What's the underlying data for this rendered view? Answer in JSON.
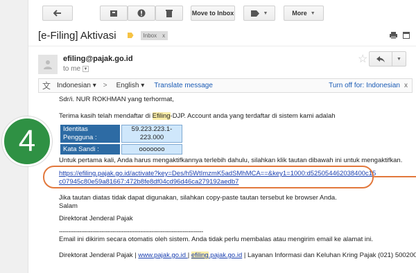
{
  "toolbar": {
    "move_to_inbox": "Move to Inbox",
    "more": "More"
  },
  "email": {
    "subject": "[e-Filing] Aktivasi",
    "label": "Inbox",
    "label_close": "x",
    "sender": "efiling@pajak.go.id",
    "to": "to me"
  },
  "translate": {
    "from": "Indonesian",
    "arrow": ">",
    "to": "English",
    "action": "Translate message",
    "turn_off": "Turn off for: Indonesian",
    "close": "x"
  },
  "message": {
    "greeting": "Sdr/i.  NUR ROKHMAN yang terhormat,",
    "intro_1": "Terima kasih telah mendaftar di ",
    "intro_hl": "Efiling",
    "intro_2": "-DJP.  Account anda yang terdaftar di sistem kami adalah",
    "id_label": "Identitas Pengguna :",
    "id_value": "59.223.223.1-223.000",
    "pass_label": "Kata Sandi :",
    "pass_value": "ooooooo",
    "activate_instr": "Untuk pertama kali, Anda harus mengaktifkannya terlebih dahulu, silahkan klik tautan dibawah ini untuk mengaktifkan.",
    "link_line1": "https://efiling.pajak.go.id/activate?key=Des/h5WtImzmK5adSMhMCA==&key1=1000:d525054462038400c15",
    "link_line2": "c07945c80e59a81667:472b8fe8df04cd96d46ca279192aedb7",
    "fallback": "Jika tautan diatas tidak dapat digunakan, silahkan copy-paste tautan tersebut ke browser Anda.",
    "salam": "Salam",
    "signature": "Direktorat Jenderal Pajak",
    "separator": "------------------------------------------------------------------------------",
    "auto_notice": "Email ini dikirim secara otomatis oleh sistem.  Anda tidak perlu membalas atau mengirim email ke alamat ini.",
    "footer_1": "Direktorat Jenderal Pajak | ",
    "footer_link1": "www.pajak.go.id ",
    "footer_sep": " | ",
    "footer_link2_hl": "efiling",
    "footer_link2_rest": ".pajak.go.id",
    "footer_2": " | Layanan Informasi dan Keluhan Kring Pajak (021) 500200"
  },
  "annotation": {
    "step_number": "4",
    "accent": "#e2783c",
    "circle_color": "#2f9144"
  }
}
